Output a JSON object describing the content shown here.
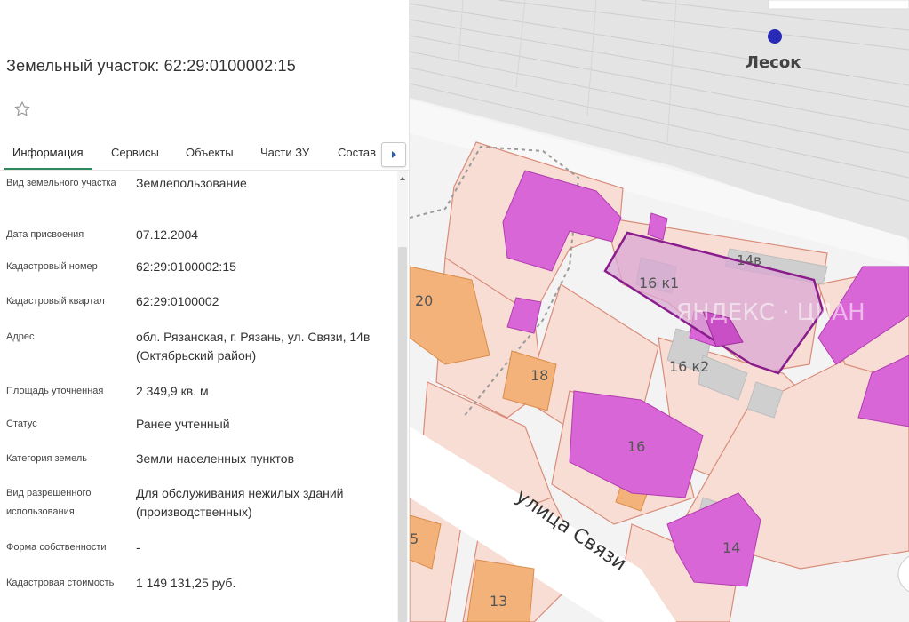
{
  "info": {
    "title": "Земельный участок: 62:29:0100002:15",
    "tabs": [
      {
        "label": "Информация",
        "active": true
      },
      {
        "label": "Сервисы",
        "active": false
      },
      {
        "label": "Объекты",
        "active": false
      },
      {
        "label": "Части ЗУ",
        "active": false
      },
      {
        "label": "Состав",
        "active": false
      }
    ],
    "rows": [
      {
        "label": "Вид земельного участка",
        "value": "Землепользование"
      },
      {
        "label": "Дата присвоения",
        "value": "07.12.2004"
      },
      {
        "label": "Кадастровый номер",
        "value": "62:29:0100002:15"
      },
      {
        "label": "Кадастровый квартал",
        "value": "62:29:0100002"
      },
      {
        "label": "Адрес",
        "value": "обл. Рязанская, г. Рязань, ул. Связи, 14в (Октябрьский район)"
      },
      {
        "label": "Площадь уточненная",
        "value": "2 349,9 кв. м"
      },
      {
        "label": "Статус",
        "value": "Ранее учтенный"
      },
      {
        "label": "Категория земель",
        "value": "Земли населенных пунктов"
      },
      {
        "label": "Вид разрешенного использования",
        "value": "Для обслуживания нежилых зданий (производственных)"
      },
      {
        "label": "Форма собственности",
        "value": "-"
      },
      {
        "label": "Кадастровая стоимость",
        "value": "1 149 131,25 руб."
      }
    ]
  },
  "icons": {
    "star": "star-outline-icon",
    "next": "chevron-right-icon"
  },
  "map": {
    "station_label": "Лесок",
    "street_label": "улица Связи",
    "selected_parcel_label": "14в",
    "building_labels": [
      "16 к1",
      "16 к2",
      "16",
      "18",
      "20",
      "14",
      "13",
      "5"
    ],
    "watermark": "ЯНДЕКС · ЦИАН",
    "colors": {
      "selected_parcel": "#8a1c8c",
      "building": "#d966d6",
      "parcel_border": "#d98c7a",
      "parcel_fill": "#f7ddd4",
      "orange_building": "#f3b27a",
      "station_dot": "#2a2ab8"
    }
  }
}
